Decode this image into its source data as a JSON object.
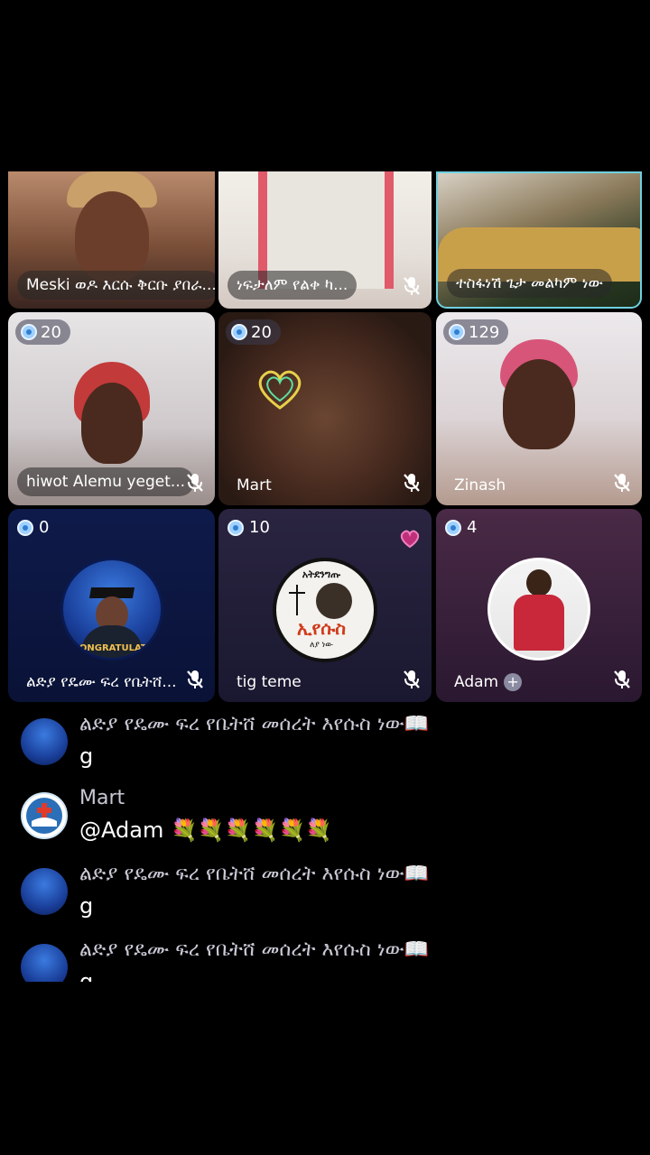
{
  "tiles": [
    {
      "name": "Meski ወዶ እርሱ ቅርቡ ያበራ...",
      "count": ""
    },
    {
      "name": "ነፍታለም የልቀ ካ...",
      "count": ""
    },
    {
      "name": "ተስፋነሽ ጌታ መልካም ነው",
      "count": ""
    },
    {
      "name": "hiwot Alemu yeget...",
      "count": "20"
    },
    {
      "name": "Mart",
      "count": "20"
    },
    {
      "name": "Zinash",
      "count": "129"
    },
    {
      "name": "ልድያ የዴሙ ፍረ የቤትሸ...",
      "count": "0"
    },
    {
      "name": "tig  teme",
      "count": "10"
    },
    {
      "name": "Adam",
      "count": "4"
    }
  ],
  "avatar_texts": {
    "congrats": "CONGRATULATI",
    "jesus_top": "አትደንግጡ",
    "jesus_main": "ኢየሱስ",
    "jesus_bottom": "ለያ ነው"
  },
  "chat": [
    {
      "user": "ልድያ የዴሙ ፍረ የቤትሸ መሰረት እየሱስ ነው📖",
      "text": "g"
    },
    {
      "user": "Mart",
      "text": "@Adam 💐💐💐💐💐💐"
    },
    {
      "user": "ልድያ የዴሙ ፍረ የቤትሸ መሰረት እየሱስ ነው📖",
      "text": "g"
    },
    {
      "user": "ልድያ የዴሙ ፍረ የቤትሸ መሰረት እየሱስ ነው📖",
      "text": "g"
    }
  ],
  "icons": {
    "mic_off": "mic-off-icon",
    "coin": "coin-icon",
    "plus": "plus-icon"
  }
}
